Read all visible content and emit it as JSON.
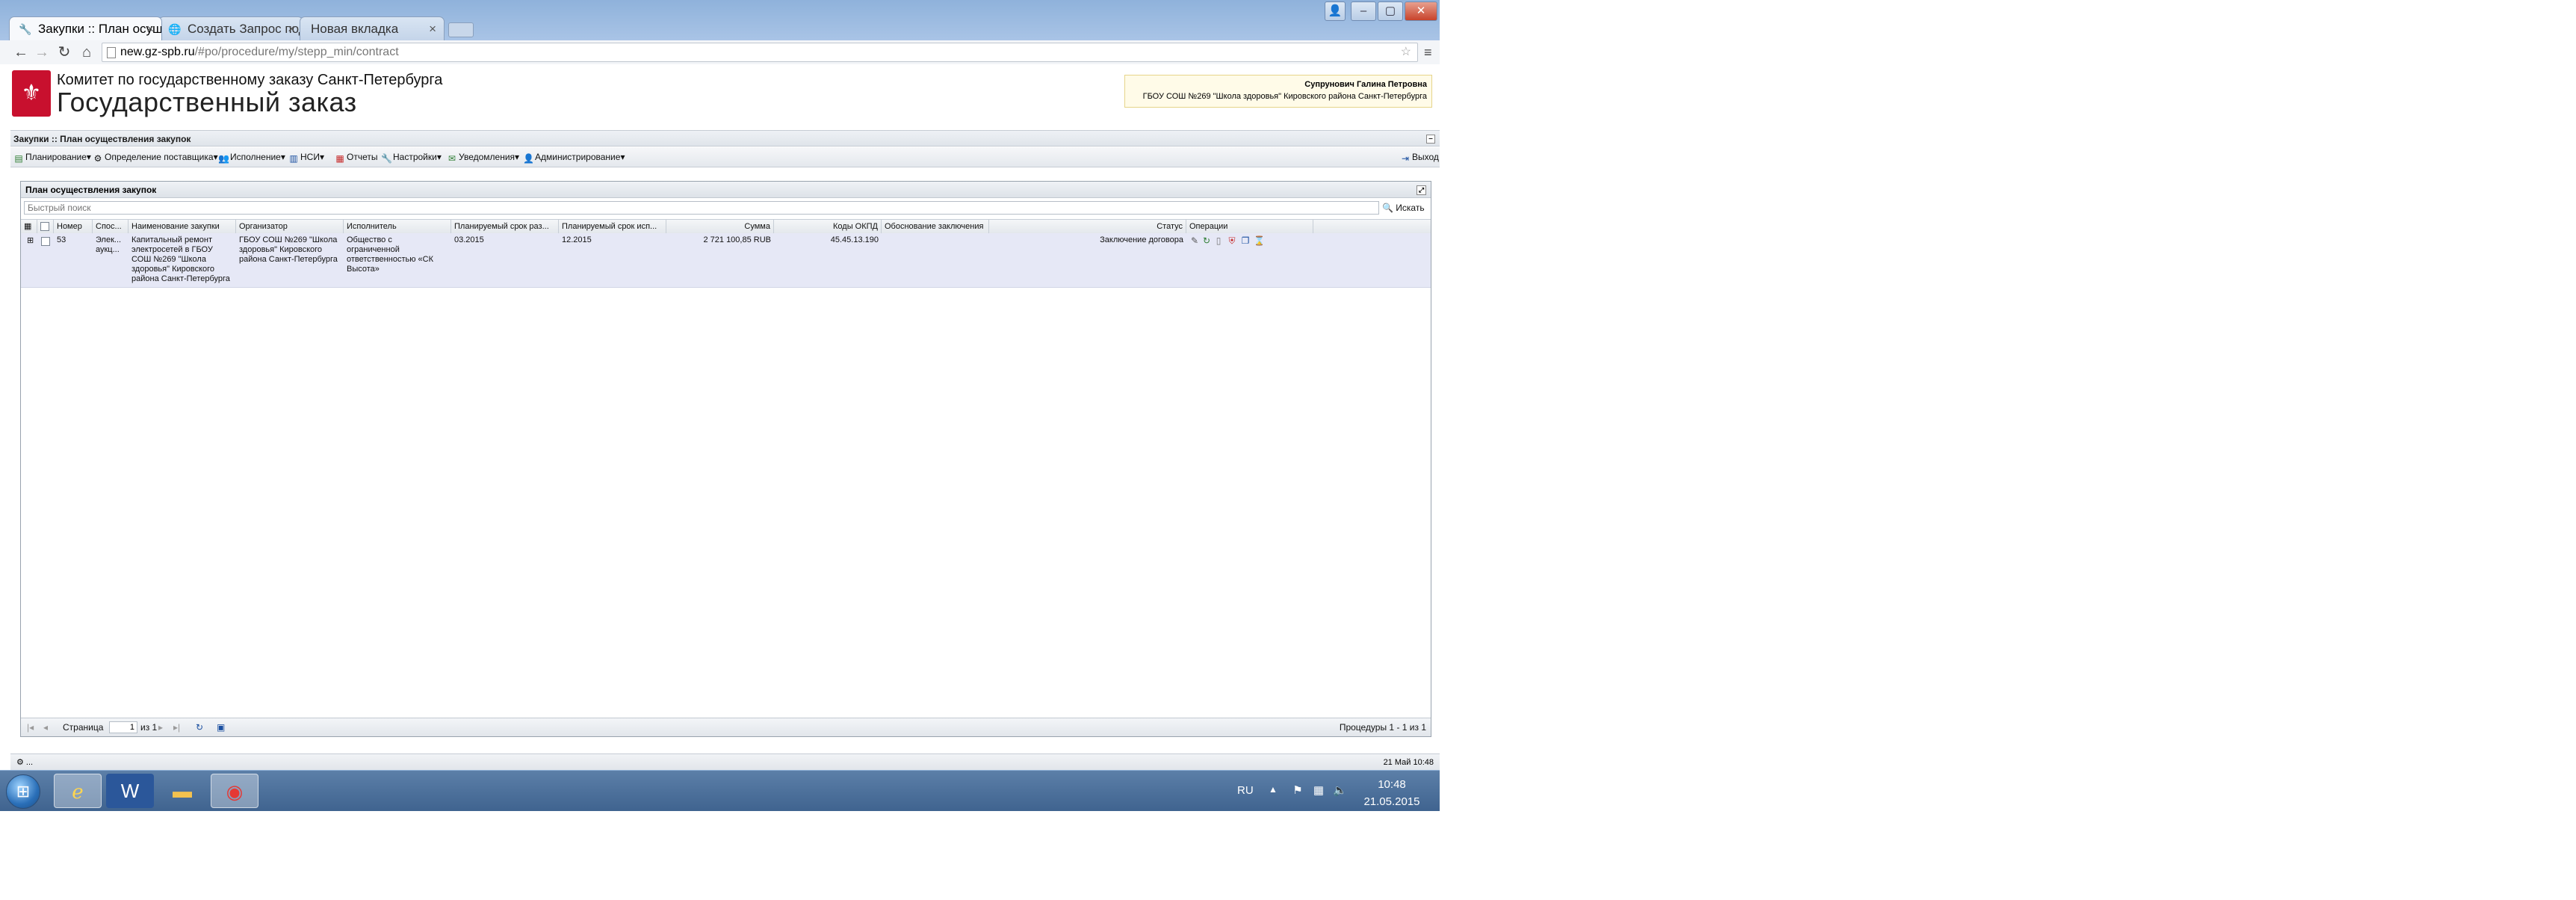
{
  "browser": {
    "tabs": [
      {
        "label": "Закупки :: План осущ",
        "active": true
      },
      {
        "label": "Создать Запрос под",
        "active": false
      },
      {
        "label": "Новая вкладка",
        "active": false
      }
    ],
    "url_host": "new.gz-spb.ru",
    "url_path": "/#po/procedure/my/stepp_min/contract"
  },
  "header": {
    "org_line": "Комитет по государственному заказу Санкт-Петербурга",
    "title": "Государственный заказ",
    "user_name": "Супрунович Галина Петровна",
    "user_org": "ГБОУ СОШ №269 \"Школа здоровья\" Кировского района Санкт-Петербурга"
  },
  "breadcrumb": "Закупки :: План осуществления закупок",
  "menu": {
    "items": [
      {
        "label": "Планирование",
        "icon": "table-icon"
      },
      {
        "label": "Определение поставщика",
        "icon": "gear-icon"
      },
      {
        "label": "Исполнение",
        "icon": "people-icon"
      },
      {
        "label": "НСИ",
        "icon": "book-icon"
      },
      {
        "label": "Отчеты",
        "icon": "report-icon"
      },
      {
        "label": "Настройки",
        "icon": "wrench-icon"
      },
      {
        "label": "Уведомления",
        "icon": "envelope-icon"
      },
      {
        "label": "Администрирование",
        "icon": "admin-icon"
      }
    ],
    "logout": "Выход"
  },
  "panel": {
    "title": "План осуществления закупок",
    "search_placeholder": "Быстрый поиск",
    "search_button": "Искать",
    "columns": [
      "Номер",
      "Спос...",
      "Наименование закупки",
      "Организатор",
      "Исполнитель",
      "Планируемый срок раз...",
      "Планируемый срок исп...",
      "Сумма",
      "Коды ОКПД",
      "Обоснование заключения",
      "Статус",
      "Операции"
    ],
    "row": {
      "number": "53",
      "method": "Элек...\nаукц...",
      "name": "Капитальный ремонт\nэлектросетей в ГБОУ\nСОШ №269 \"Школа\nздоровья\" Кировского\nрайона Санкт-Петербурга",
      "organizer": "ГБОУ СОШ №269 \"Школа\nздоровья\" Кировского\nрайона Санкт-Петербурга",
      "executor": "Общество с\nограниченной\nответственностью «СК\nВысота»",
      "placement_term": "03.2015",
      "execution_term": "12.2015",
      "amount": "2 721 100,85 RUB",
      "okpd": "45.45.13.190",
      "justification": "",
      "status": "Заключение договора"
    },
    "pager": {
      "page_label": "Страница",
      "page_value": "1",
      "of_label": "из 1",
      "summary": "Процедуры 1 - 1 из 1"
    }
  },
  "statusbar": {
    "left": "⚙ ...",
    "right": "21 Май 10:48"
  },
  "taskbar": {
    "lang": "RU",
    "time": "10:48",
    "date": "21.05.2015"
  }
}
